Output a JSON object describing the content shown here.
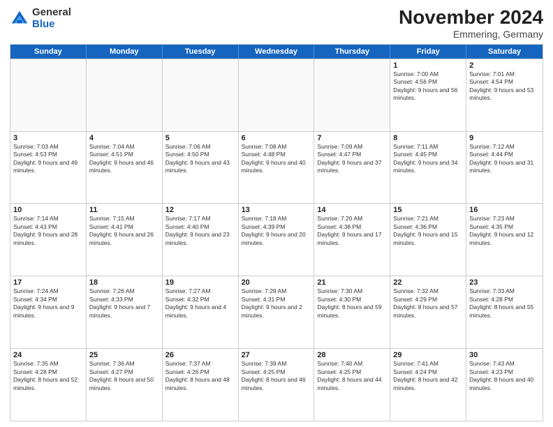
{
  "logo": {
    "general": "General",
    "blue": "Blue"
  },
  "header": {
    "month": "November 2024",
    "location": "Emmering, Germany"
  },
  "weekdays": [
    "Sunday",
    "Monday",
    "Tuesday",
    "Wednesday",
    "Thursday",
    "Friday",
    "Saturday"
  ],
  "rows": [
    [
      {
        "day": "",
        "info": "",
        "empty": true
      },
      {
        "day": "",
        "info": "",
        "empty": true
      },
      {
        "day": "",
        "info": "",
        "empty": true
      },
      {
        "day": "",
        "info": "",
        "empty": true
      },
      {
        "day": "",
        "info": "",
        "empty": true
      },
      {
        "day": "1",
        "info": "Sunrise: 7:00 AM\nSunset: 4:56 PM\nDaylight: 9 hours and 56 minutes.",
        "empty": false
      },
      {
        "day": "2",
        "info": "Sunrise: 7:01 AM\nSunset: 4:54 PM\nDaylight: 9 hours and 53 minutes.",
        "empty": false
      }
    ],
    [
      {
        "day": "3",
        "info": "Sunrise: 7:03 AM\nSunset: 4:53 PM\nDaylight: 9 hours and 49 minutes.",
        "empty": false
      },
      {
        "day": "4",
        "info": "Sunrise: 7:04 AM\nSunset: 4:51 PM\nDaylight: 9 hours and 46 minutes.",
        "empty": false
      },
      {
        "day": "5",
        "info": "Sunrise: 7:06 AM\nSunset: 4:50 PM\nDaylight: 9 hours and 43 minutes.",
        "empty": false
      },
      {
        "day": "6",
        "info": "Sunrise: 7:08 AM\nSunset: 4:48 PM\nDaylight: 9 hours and 40 minutes.",
        "empty": false
      },
      {
        "day": "7",
        "info": "Sunrise: 7:09 AM\nSunset: 4:47 PM\nDaylight: 9 hours and 37 minutes.",
        "empty": false
      },
      {
        "day": "8",
        "info": "Sunrise: 7:11 AM\nSunset: 4:45 PM\nDaylight: 9 hours and 34 minutes.",
        "empty": false
      },
      {
        "day": "9",
        "info": "Sunrise: 7:12 AM\nSunset: 4:44 PM\nDaylight: 9 hours and 31 minutes.",
        "empty": false
      }
    ],
    [
      {
        "day": "10",
        "info": "Sunrise: 7:14 AM\nSunset: 4:43 PM\nDaylight: 9 hours and 28 minutes.",
        "empty": false
      },
      {
        "day": "11",
        "info": "Sunrise: 7:15 AM\nSunset: 4:41 PM\nDaylight: 9 hours and 26 minutes.",
        "empty": false
      },
      {
        "day": "12",
        "info": "Sunrise: 7:17 AM\nSunset: 4:40 PM\nDaylight: 9 hours and 23 minutes.",
        "empty": false
      },
      {
        "day": "13",
        "info": "Sunrise: 7:18 AM\nSunset: 4:39 PM\nDaylight: 9 hours and 20 minutes.",
        "empty": false
      },
      {
        "day": "14",
        "info": "Sunrise: 7:20 AM\nSunset: 4:38 PM\nDaylight: 9 hours and 17 minutes.",
        "empty": false
      },
      {
        "day": "15",
        "info": "Sunrise: 7:21 AM\nSunset: 4:36 PM\nDaylight: 9 hours and 15 minutes.",
        "empty": false
      },
      {
        "day": "16",
        "info": "Sunrise: 7:23 AM\nSunset: 4:35 PM\nDaylight: 9 hours and 12 minutes.",
        "empty": false
      }
    ],
    [
      {
        "day": "17",
        "info": "Sunrise: 7:24 AM\nSunset: 4:34 PM\nDaylight: 9 hours and 9 minutes.",
        "empty": false
      },
      {
        "day": "18",
        "info": "Sunrise: 7:26 AM\nSunset: 4:33 PM\nDaylight: 9 hours and 7 minutes.",
        "empty": false
      },
      {
        "day": "19",
        "info": "Sunrise: 7:27 AM\nSunset: 4:32 PM\nDaylight: 9 hours and 4 minutes.",
        "empty": false
      },
      {
        "day": "20",
        "info": "Sunrise: 7:29 AM\nSunset: 4:31 PM\nDaylight: 9 hours and 2 minutes.",
        "empty": false
      },
      {
        "day": "21",
        "info": "Sunrise: 7:30 AM\nSunset: 4:30 PM\nDaylight: 8 hours and 59 minutes.",
        "empty": false
      },
      {
        "day": "22",
        "info": "Sunrise: 7:32 AM\nSunset: 4:29 PM\nDaylight: 8 hours and 57 minutes.",
        "empty": false
      },
      {
        "day": "23",
        "info": "Sunrise: 7:33 AM\nSunset: 4:28 PM\nDaylight: 8 hours and 55 minutes.",
        "empty": false
      }
    ],
    [
      {
        "day": "24",
        "info": "Sunrise: 7:35 AM\nSunset: 4:28 PM\nDaylight: 8 hours and 52 minutes.",
        "empty": false
      },
      {
        "day": "25",
        "info": "Sunrise: 7:36 AM\nSunset: 4:27 PM\nDaylight: 8 hours and 50 minutes.",
        "empty": false
      },
      {
        "day": "26",
        "info": "Sunrise: 7:37 AM\nSunset: 4:26 PM\nDaylight: 8 hours and 48 minutes.",
        "empty": false
      },
      {
        "day": "27",
        "info": "Sunrise: 7:39 AM\nSunset: 4:25 PM\nDaylight: 8 hours and 46 minutes.",
        "empty": false
      },
      {
        "day": "28",
        "info": "Sunrise: 7:40 AM\nSunset: 4:25 PM\nDaylight: 8 hours and 44 minutes.",
        "empty": false
      },
      {
        "day": "29",
        "info": "Sunrise: 7:41 AM\nSunset: 4:24 PM\nDaylight: 8 hours and 42 minutes.",
        "empty": false
      },
      {
        "day": "30",
        "info": "Sunrise: 7:43 AM\nSunset: 4:23 PM\nDaylight: 8 hours and 40 minutes.",
        "empty": false
      }
    ]
  ]
}
